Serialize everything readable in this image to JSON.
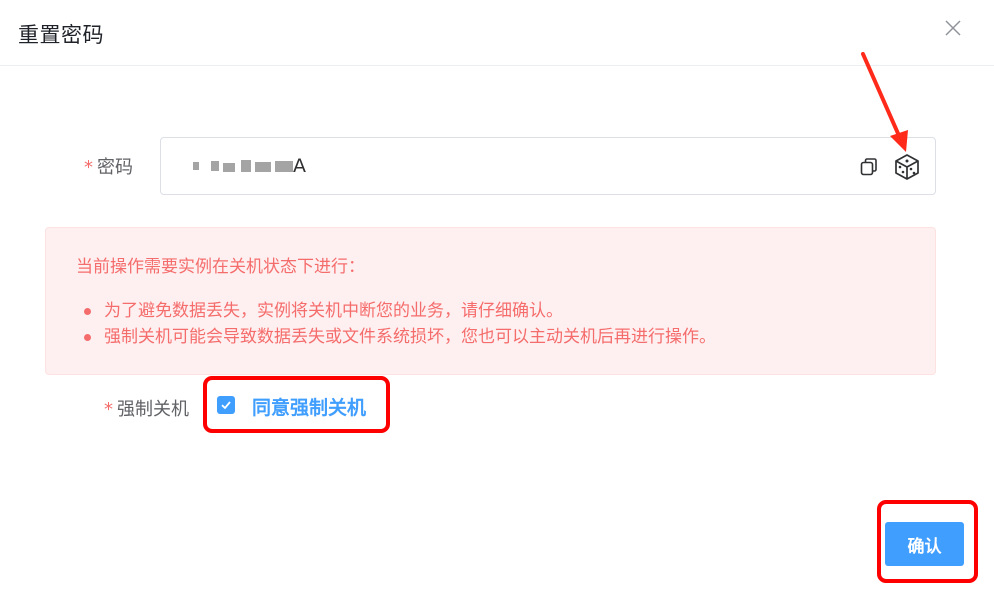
{
  "dialog": {
    "title": "重置密码"
  },
  "password": {
    "required_mark": "*",
    "label": "密码",
    "value_visible_tail": "A"
  },
  "alert": {
    "title": "当前操作需要实例在关机状态下进行：",
    "items": [
      "为了避免数据丢失，实例将关机中断您的业务，请仔细确认。",
      "强制关机可能会导致数据丢失或文件系统损坏，您也可以主动关机后再进行操作。"
    ]
  },
  "force_shutdown": {
    "required_mark": "*",
    "label": "强制关机",
    "checkbox_label": "同意强制关机",
    "checked": true
  },
  "footer": {
    "confirm_label": "确认"
  },
  "icons": {
    "close": "close-icon",
    "copy": "copy-icon",
    "generate": "dice-icon",
    "check": "check-icon"
  },
  "colors": {
    "primary": "#409eff",
    "danger": "#f56c6c",
    "alert_bg": "#fef0f0",
    "annotation": "#ff0000"
  }
}
